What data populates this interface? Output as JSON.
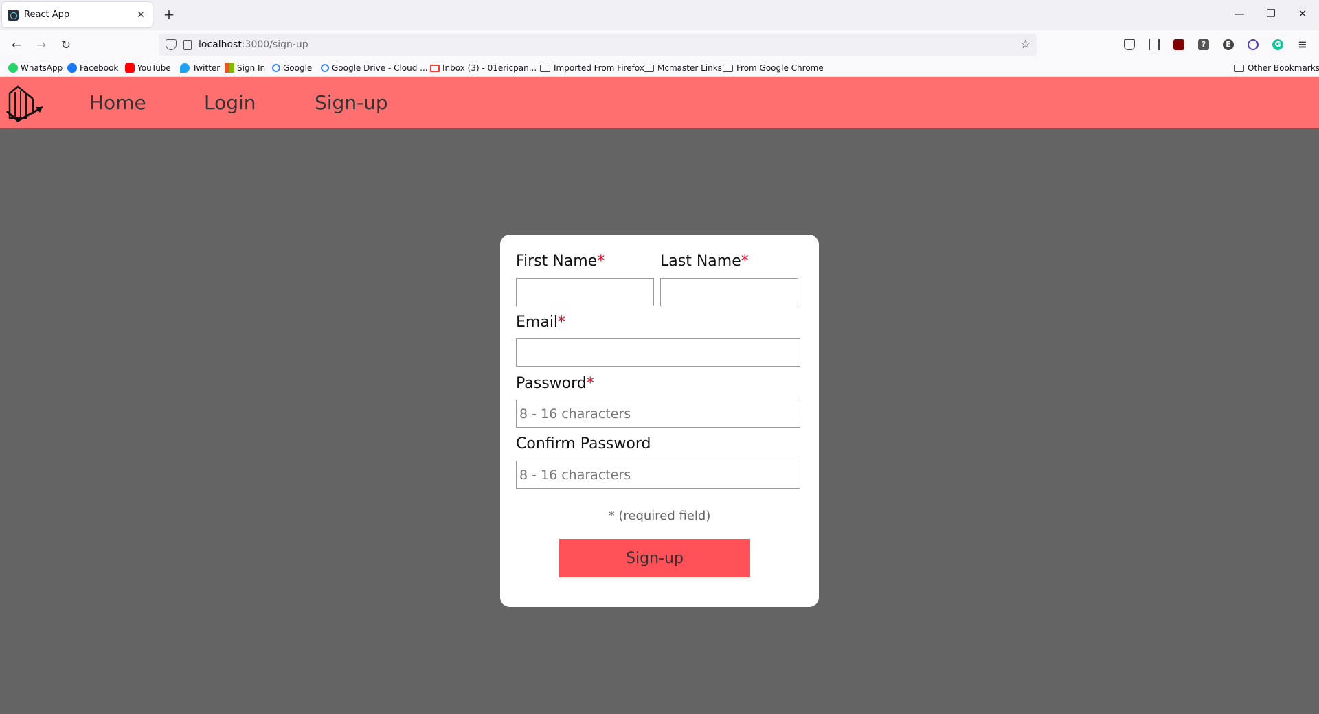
{
  "browser": {
    "tab": {
      "title": "React App",
      "close_glyph": "✕"
    },
    "new_tab_glyph": "+",
    "window_controls": {
      "minimize": "—",
      "restore": "❐",
      "close": "✕"
    },
    "nav": {
      "back": "←",
      "forward": "→",
      "reload": "↻"
    },
    "url": {
      "host": "localhost",
      "path": ":3000/sign-up"
    },
    "bookmark_star": "☆",
    "bookmarks": [
      {
        "label": "WhatsApp",
        "icon": "whatsapp-icon",
        "color": "#25d366"
      },
      {
        "label": "Facebook",
        "icon": "facebook-icon",
        "color": "#1877f2"
      },
      {
        "label": "YouTube",
        "icon": "youtube-icon",
        "color": "#ff0000"
      },
      {
        "label": "Twitter",
        "icon": "twitter-icon",
        "color": "#1da1f2"
      },
      {
        "label": "Sign In",
        "icon": "microsoft-icon",
        "color": "#f25022"
      },
      {
        "label": "Google",
        "icon": "google-icon",
        "color": "#4285f4"
      },
      {
        "label": "Google Drive - Cloud ...",
        "icon": "google-icon",
        "color": "#4285f4"
      },
      {
        "label": "Inbox (3) - 01ericpan...",
        "icon": "gmail-icon",
        "color": "#ea4335"
      },
      {
        "label": "Imported From Firefox",
        "icon": "folder-icon"
      },
      {
        "label": "Mcmaster Links",
        "icon": "folder-icon"
      },
      {
        "label": "From Google Chrome",
        "icon": "folder-icon"
      }
    ],
    "other_bookmarks": "Other Bookmarks"
  },
  "app": {
    "nav": {
      "home": "Home",
      "login": "Login",
      "signup": "Sign-up"
    },
    "colors": {
      "header": "#ff6f6f",
      "button": "#ff5157",
      "background": "#646464",
      "required": "#e0102a"
    }
  },
  "form": {
    "first_name": {
      "label": "First Name",
      "value": ""
    },
    "last_name": {
      "label": "Last Name",
      "value": ""
    },
    "email": {
      "label": "Email",
      "value": ""
    },
    "password": {
      "label": "Password",
      "placeholder": "8 - 16 characters"
    },
    "confirm_password": {
      "label": "Confirm Password",
      "placeholder": "8 - 16 characters"
    },
    "required_marker": "*",
    "required_note": "* (required field)",
    "submit_label": "Sign-up"
  }
}
